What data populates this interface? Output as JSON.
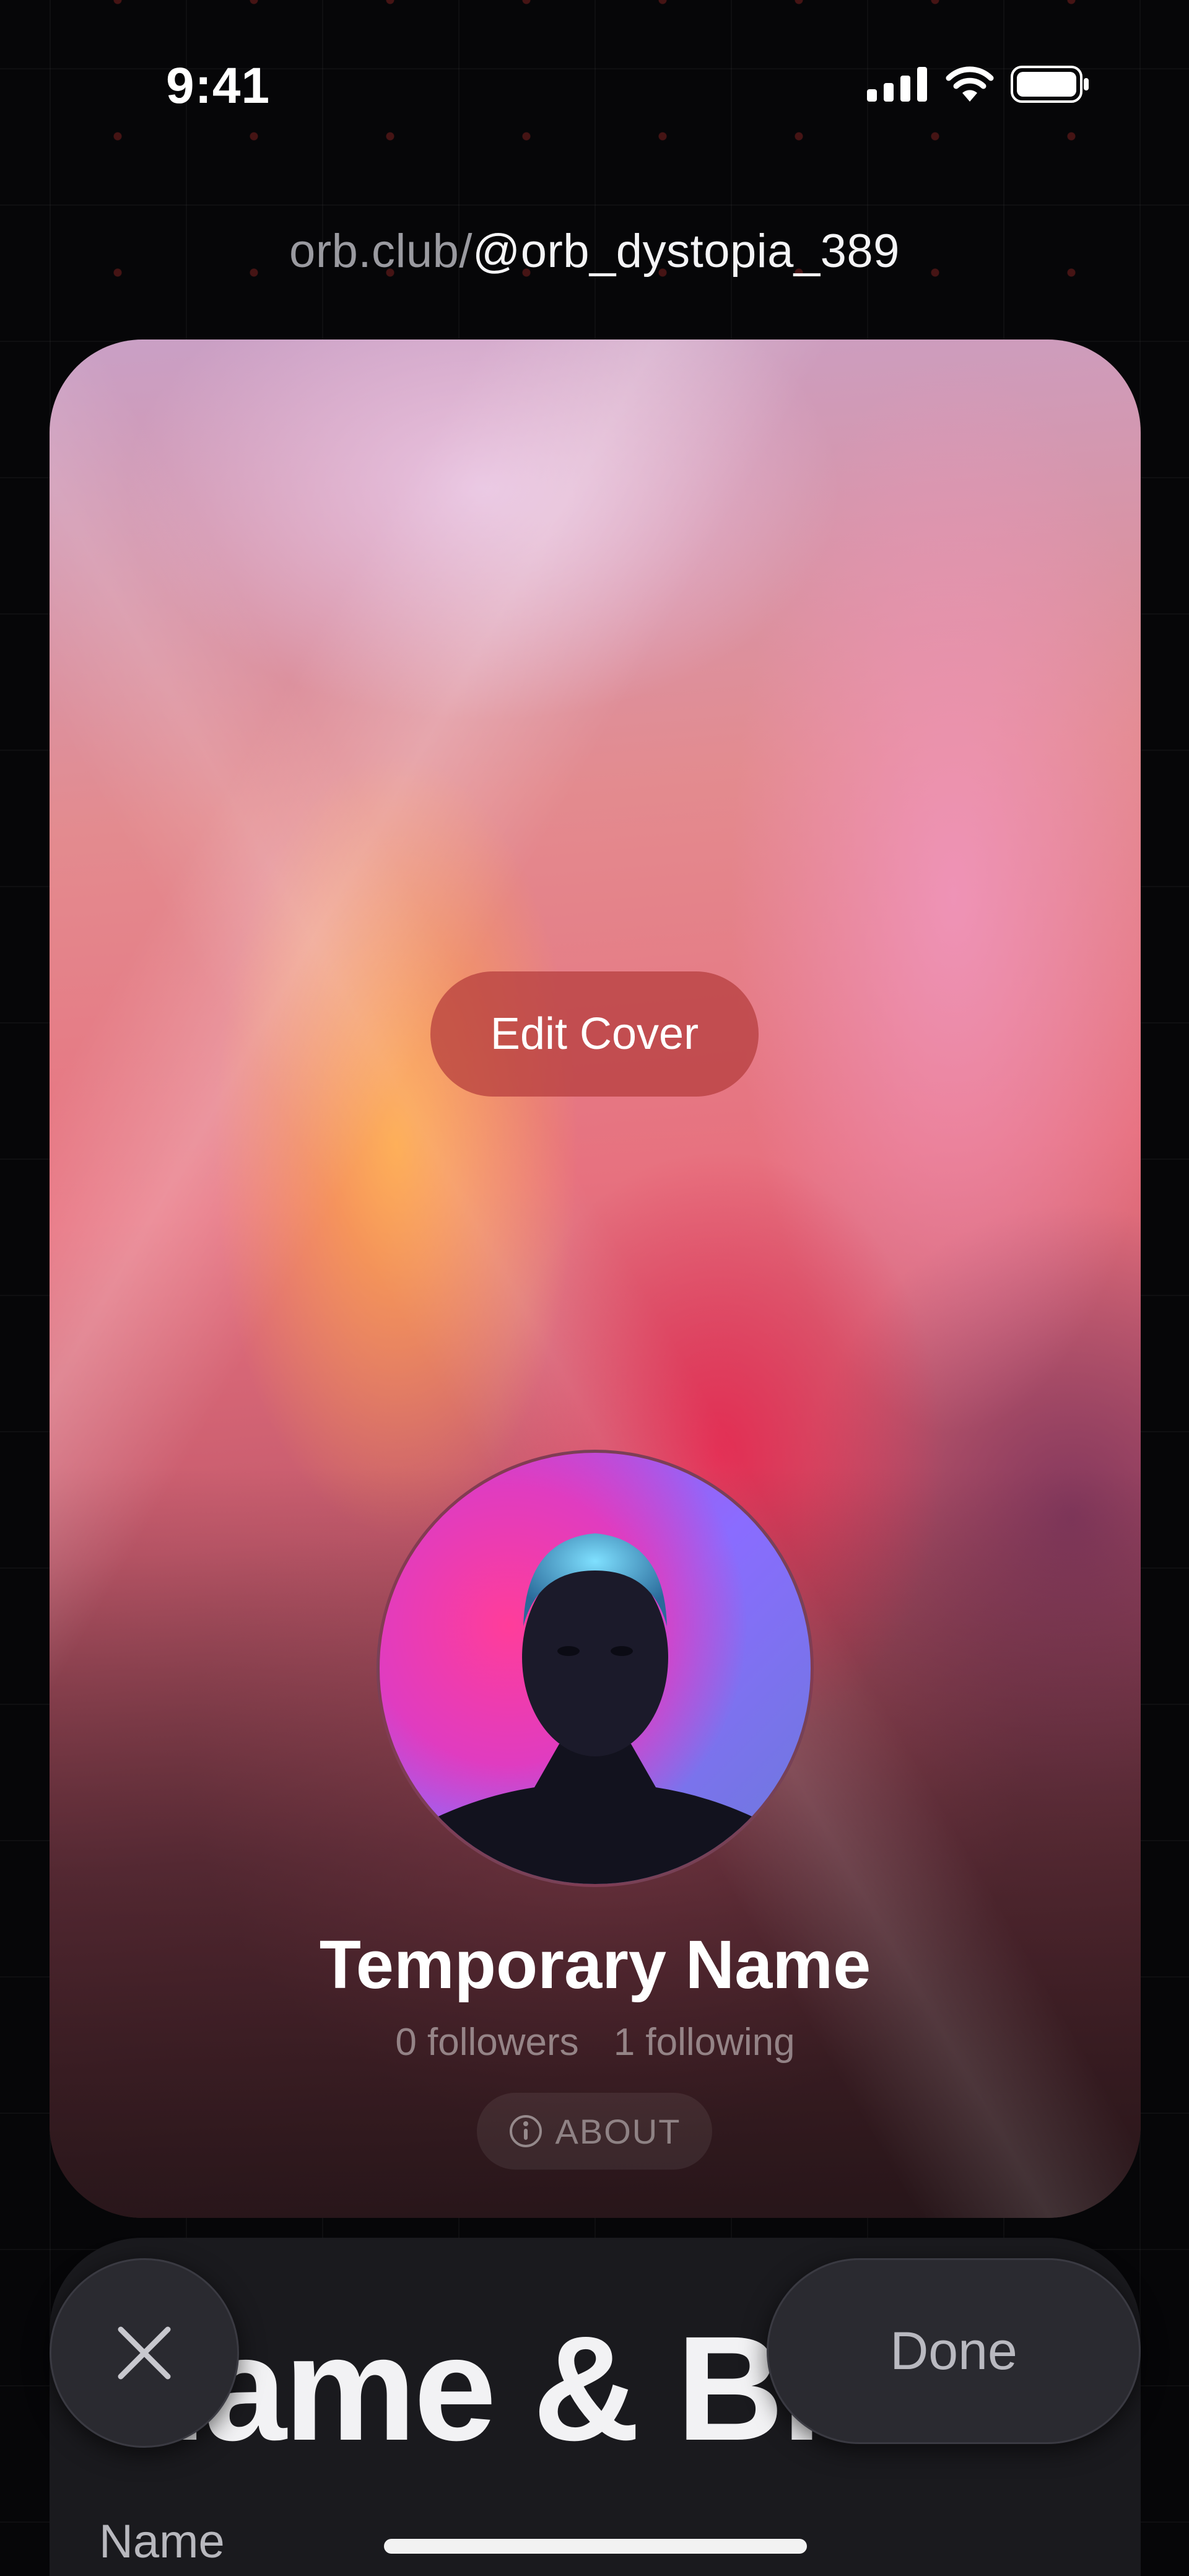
{
  "status_bar": {
    "time": "9:41"
  },
  "url": {
    "domain": "orb.club/",
    "handle": "@orb_dystopia_389"
  },
  "cover": {
    "edit_label": "Edit Cover"
  },
  "profile": {
    "name": "Temporary Name",
    "followers": "0 followers",
    "following": "1 following",
    "about_label": "ABOUT"
  },
  "editor": {
    "title": "Name & Bio",
    "name_label": "Name",
    "done_label": "Done"
  },
  "colors": {
    "background": "#060608",
    "panel": "#1a1a1e",
    "edit_cover_pill": "#b43c3c"
  },
  "icons": [
    "signal-icon",
    "wifi-icon",
    "battery-icon",
    "info-icon",
    "close-icon"
  ]
}
